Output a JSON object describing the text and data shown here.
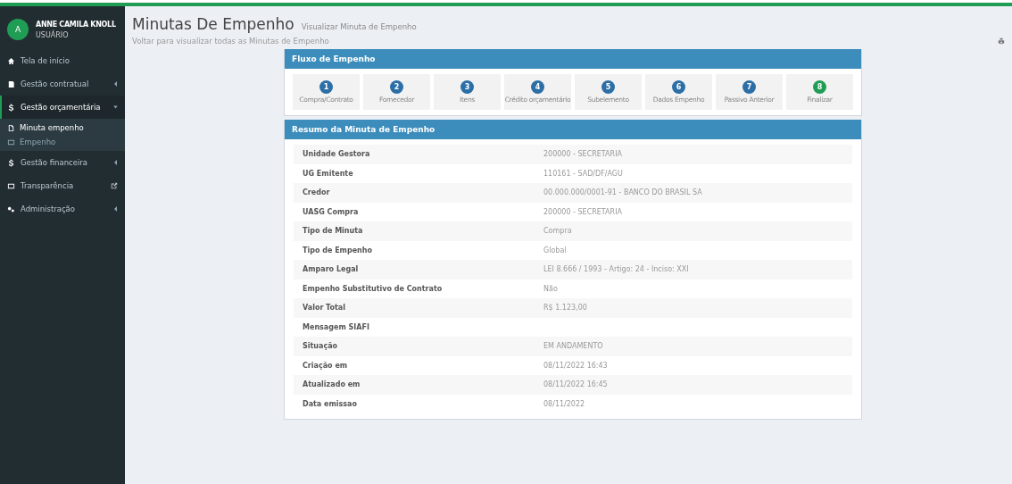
{
  "user": {
    "initial": "A",
    "name": "ANNE CAMILA KNOLL",
    "role": "USUÁRIO"
  },
  "sidebar": {
    "items": [
      {
        "label": "Tela de início",
        "expanded": false,
        "arrow": false,
        "external": false
      },
      {
        "label": "Gestão contratual",
        "expanded": false,
        "arrow": true,
        "external": false
      },
      {
        "label": "Gestão orçamentária",
        "expanded": true,
        "arrow": true,
        "external": false,
        "children": [
          {
            "label": "Minuta empenho",
            "selected": true
          },
          {
            "label": "Empenho",
            "selected": false
          }
        ]
      },
      {
        "label": "Gestão financeira",
        "expanded": false,
        "arrow": true,
        "external": false
      },
      {
        "label": "Transparência",
        "expanded": false,
        "arrow": false,
        "external": true
      },
      {
        "label": "Administração",
        "expanded": false,
        "arrow": true,
        "external": false
      }
    ]
  },
  "page": {
    "title": "Minutas De Empenho",
    "subtitle": "Visualizar Minuta de Empenho",
    "back_link": "Voltar para visualizar todas as Minutas de Empenho"
  },
  "flow": {
    "title": "Fluxo de Empenho",
    "steps": [
      {
        "number": "1",
        "label": "Compra/Contrato",
        "selected": false
      },
      {
        "number": "2",
        "label": "Fornecedor",
        "selected": false
      },
      {
        "number": "3",
        "label": "Itens",
        "selected": false
      },
      {
        "number": "4",
        "label": "Crédito orçamentário",
        "selected": false
      },
      {
        "number": "5",
        "label": "Subelemento",
        "selected": false
      },
      {
        "number": "6",
        "label": "Dados Empenho",
        "selected": false
      },
      {
        "number": "7",
        "label": "Passivo Anterior",
        "selected": false
      },
      {
        "number": "8",
        "label": "Finalizar",
        "selected": true
      }
    ]
  },
  "summary": {
    "title": "Resumo da Minuta de Empenho",
    "rows": [
      {
        "label": "Unidade Gestora",
        "value": "200000 - SECRETARIA"
      },
      {
        "label": "UG Emitente",
        "value": "110161 - SAD/DF/AGU"
      },
      {
        "label": "Credor",
        "value": "00.000.000/0001-91 - BANCO DO BRASIL SA"
      },
      {
        "label": "UASG Compra",
        "value": "200000 - SECRETARIA"
      },
      {
        "label": "Tipo de Minuta",
        "value": "Compra"
      },
      {
        "label": "Tipo de Empenho",
        "value": "Global"
      },
      {
        "label": "Amparo Legal",
        "value": "LEI 8.666 / 1993 - Artigo: 24 - Inciso: XXI"
      },
      {
        "label": "Empenho Substitutivo de Contrato",
        "value": "Não"
      },
      {
        "label": "Valor Total",
        "value": "R$ 1.123,00"
      },
      {
        "label": "Mensagem SIAFI"
      },
      {
        "label": "Situação",
        "value": "EM ANDAMENTO"
      },
      {
        "label": "Criação em",
        "value": "08/11/2022 16:43"
      },
      {
        "label": "Atualizado em",
        "value": "08/11/2022 16:45"
      },
      {
        "label": "Data emissao",
        "value": "08/11/2022"
      }
    ]
  }
}
